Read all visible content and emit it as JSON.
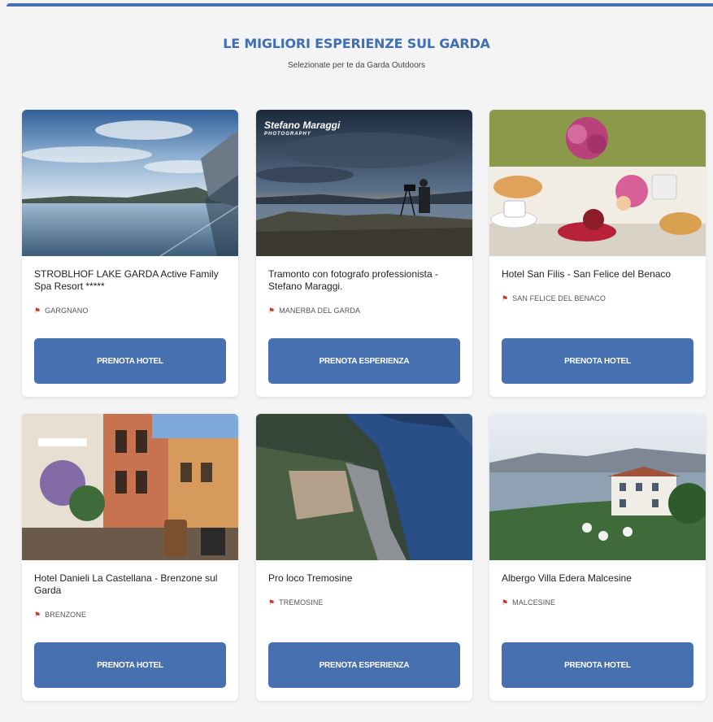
{
  "section": {
    "title": "LE MIGLIORI ESPERIENZE SUL GARDA",
    "subtitle": "Selezionate per te da Garda Outdoors"
  },
  "cards": [
    {
      "name": "STROBLHOF LAKE GARDA Active Family Spa Resort *****",
      "location": "GARGNANO",
      "button": "PRENOTA HOTEL",
      "image": "infinity-pool-lake"
    },
    {
      "name": "Tramonto con fotografo professionista - Stefano Maraggi.",
      "location": "MANERBA DEL GARDA",
      "button": "PRENOTA ESPERIENZA",
      "image": "photographer-sunset",
      "watermark": "Stefano Maraggi",
      "watermark_sub": "PHOTOGRAPHY"
    },
    {
      "name": "Hotel San Filis - San Felice del Benaco",
      "location": "SAN FELICE DEL BENACO",
      "button": "PRENOTA HOTEL",
      "image": "breakfast-table"
    },
    {
      "name": "Hotel Danieli La Castellana - Brenzone sul Garda",
      "location": "BRENZONE",
      "button": "PRENOTA HOTEL",
      "image": "hotel-street-facade"
    },
    {
      "name": "Pro loco Tremosine",
      "location": "TREMOSINE",
      "button": "PRENOTA ESPERIENZA",
      "image": "aerial-cliff-lake"
    },
    {
      "name": "Albergo Villa Edera Malcesine",
      "location": "MALCESINE",
      "button": "PRENOTA HOTEL",
      "image": "villa-lakeside"
    }
  ]
}
